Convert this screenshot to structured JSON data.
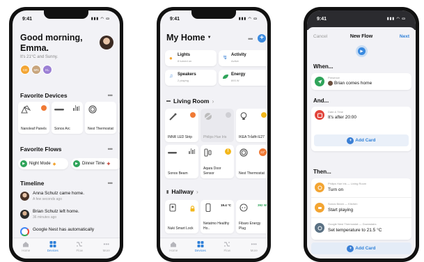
{
  "phone1": {
    "time": "9:41",
    "greeting": "Good morning, Emma.",
    "weather": "It's 21°C and Sunny.",
    "avatars": [
      {
        "initials": "CD",
        "color": "#f3a533"
      },
      {
        "initials": "MN",
        "color": "#c8a57d"
      },
      {
        "initials": "KL",
        "color": "#9b7fd4"
      }
    ],
    "favorite_devices_title": "Favorite Devices",
    "devices": [
      {
        "name": "Nanoleaf Panels",
        "icon": "nanoleaf-icon",
        "dot": "#f07a35"
      },
      {
        "name": "Sonos Arc",
        "icon": "soundbar-icon"
      },
      {
        "name": "Nest Thermostat",
        "icon": "thermostat-icon"
      }
    ],
    "favorite_flows_title": "Favorite Flows",
    "flows": [
      "Night Mode",
      "Dinner Time"
    ],
    "timeline_title": "Timeline",
    "timeline": [
      {
        "name": "Anna Schulz",
        "action": "came home.",
        "time": "A few seconds ago"
      },
      {
        "name": "Brian Schulz",
        "action": "left home.",
        "time": "36 minutes ago"
      },
      {
        "name": "Google Nest",
        "action": "has automatically",
        "time": ""
      }
    ],
    "tabs": [
      "Home",
      "Devices",
      "Flow",
      "More"
    ]
  },
  "phone2": {
    "time": "9:41",
    "title": "My Home",
    "summary": [
      {
        "label": "Lights",
        "sub": "8 turned on",
        "icon": "bulb-icon",
        "color": "#f3a533"
      },
      {
        "label": "Activity",
        "sub": "Active",
        "icon": "activity-icon",
        "color": "#3b82d6"
      },
      {
        "label": "Speakers",
        "sub": "2 playing",
        "icon": "speaker-icon",
        "color": "#3b82d6"
      },
      {
        "label": "Energy",
        "sub": "893 W",
        "icon": "leaf-icon",
        "color": "#2fa45a"
      }
    ],
    "living_room_title": "Living Room",
    "living_room": [
      {
        "name": "INNR LED Strip",
        "icon": "ledstrip-icon",
        "dot": "#f07a35",
        "dim": false
      },
      {
        "name": "Philips Hue Iris",
        "icon": "hue-iris-icon",
        "dot": "#cfcfd4",
        "dim": true
      },
      {
        "name": "IKEA Trådfri E27",
        "icon": "bulb-icon",
        "dot": "#f3b71b",
        "dim": false
      },
      {
        "name": "Sonos Beam",
        "icon": "soundbar-icon",
        "dot": "",
        "dim": false
      },
      {
        "name": "Aqara Door Sensor",
        "icon": "door-icon",
        "dot": "#f3b71b",
        "dim": false
      },
      {
        "name": "Nest Thermostat",
        "icon": "thermostat-icon",
        "dot": "#f07a35",
        "dot_text": "22°",
        "dim": false
      }
    ],
    "hallway_title": "Hallway",
    "hallway": [
      {
        "name": "Nuki Smart Lock",
        "icon": "lock-icon",
        "value": "",
        "value_color": "#f3b71b"
      },
      {
        "name": "Netatmo Healthy Ho..",
        "icon": "netatmo-icon",
        "value": "19.4 °C",
        "value_color": "#111"
      },
      {
        "name": "Fibaro Energy Plug",
        "icon": "plug-icon",
        "value": "392 W",
        "value_color": "#2fa45a"
      }
    ],
    "tabs": [
      "Home",
      "Devices",
      "Flow",
      "More"
    ]
  },
  "phone3": {
    "time": "9:41",
    "cancel": "Cancel",
    "title": "New Flow",
    "next": "Next",
    "when_title": "When...",
    "when_card": {
      "small": "Presence",
      "text": "Brian comes home",
      "color": "#2fa45a"
    },
    "and_title": "And...",
    "and_card": {
      "small": "Date & Time",
      "text": "It's after 20:00",
      "color": "#e2453c"
    },
    "add_card": "Add Card",
    "then_title": "Then...",
    "then_cards": [
      {
        "small": "Philips Hue Iris — Living Room",
        "text": "Turn on",
        "color": "#f3a533"
      },
      {
        "small": "Sonos Beam — Kitchen",
        "text": "Start playing",
        "color": "#f3a533"
      },
      {
        "small": "Google Nest Thermostat — Downstairs",
        "text": "Set temperature to 21.5 °C",
        "color": "#5a7184"
      }
    ]
  }
}
